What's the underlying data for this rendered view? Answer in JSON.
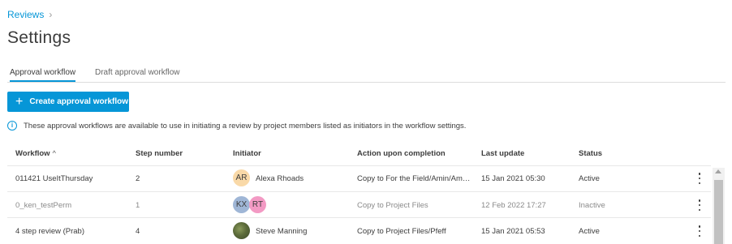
{
  "breadcrumb": {
    "label": "Reviews",
    "separator": "›"
  },
  "page": {
    "title": "Settings"
  },
  "tabs": [
    {
      "label": "Approval workflow",
      "active": true
    },
    {
      "label": "Draft approval workflow",
      "active": false
    }
  ],
  "toolbar": {
    "create_label": "Create approval workflow",
    "create_icon": "plus-icon"
  },
  "info": {
    "icon": "info-icon",
    "glyph": "i",
    "text": "These approval workflows are available to use in initiating a review by project members listed as initiators in the workflow settings."
  },
  "table": {
    "columns": [
      "Workflow",
      "Step number",
      "Initiator",
      "Action upon completion",
      "Last update",
      "Status"
    ],
    "sort_indicator": "^",
    "rows": [
      {
        "workflow": "011421 UseItThursday",
        "step": "2",
        "initiator_badges": [
          "AR"
        ],
        "initiator_name": "Alexa Rhoads",
        "action": "Copy to For the Field/Amin/Am…",
        "updated": "15 Jan 2021 05:30",
        "status": "Active"
      },
      {
        "workflow": "0_ken_testPerm",
        "step": "1",
        "initiator_badges": [
          "KX",
          "RT"
        ],
        "initiator_name": "",
        "action": "Copy to Project Files",
        "updated": "12 Feb 2022 17:27",
        "status": "Inactive"
      },
      {
        "workflow": "4 step review (Prab)",
        "step": "4",
        "initiator_badges": [],
        "initiator_name": "Steve Manning",
        "action": "Copy to Project Files/Pfeff",
        "updated": "15 Jan 2021 05:53",
        "status": "Active"
      }
    ]
  },
  "colors": {
    "accent": "#0696d7",
    "avatar_ar": "#f9d9a8",
    "avatar_kx": "#9fb6d6",
    "avatar_rt": "#f39ac4"
  }
}
